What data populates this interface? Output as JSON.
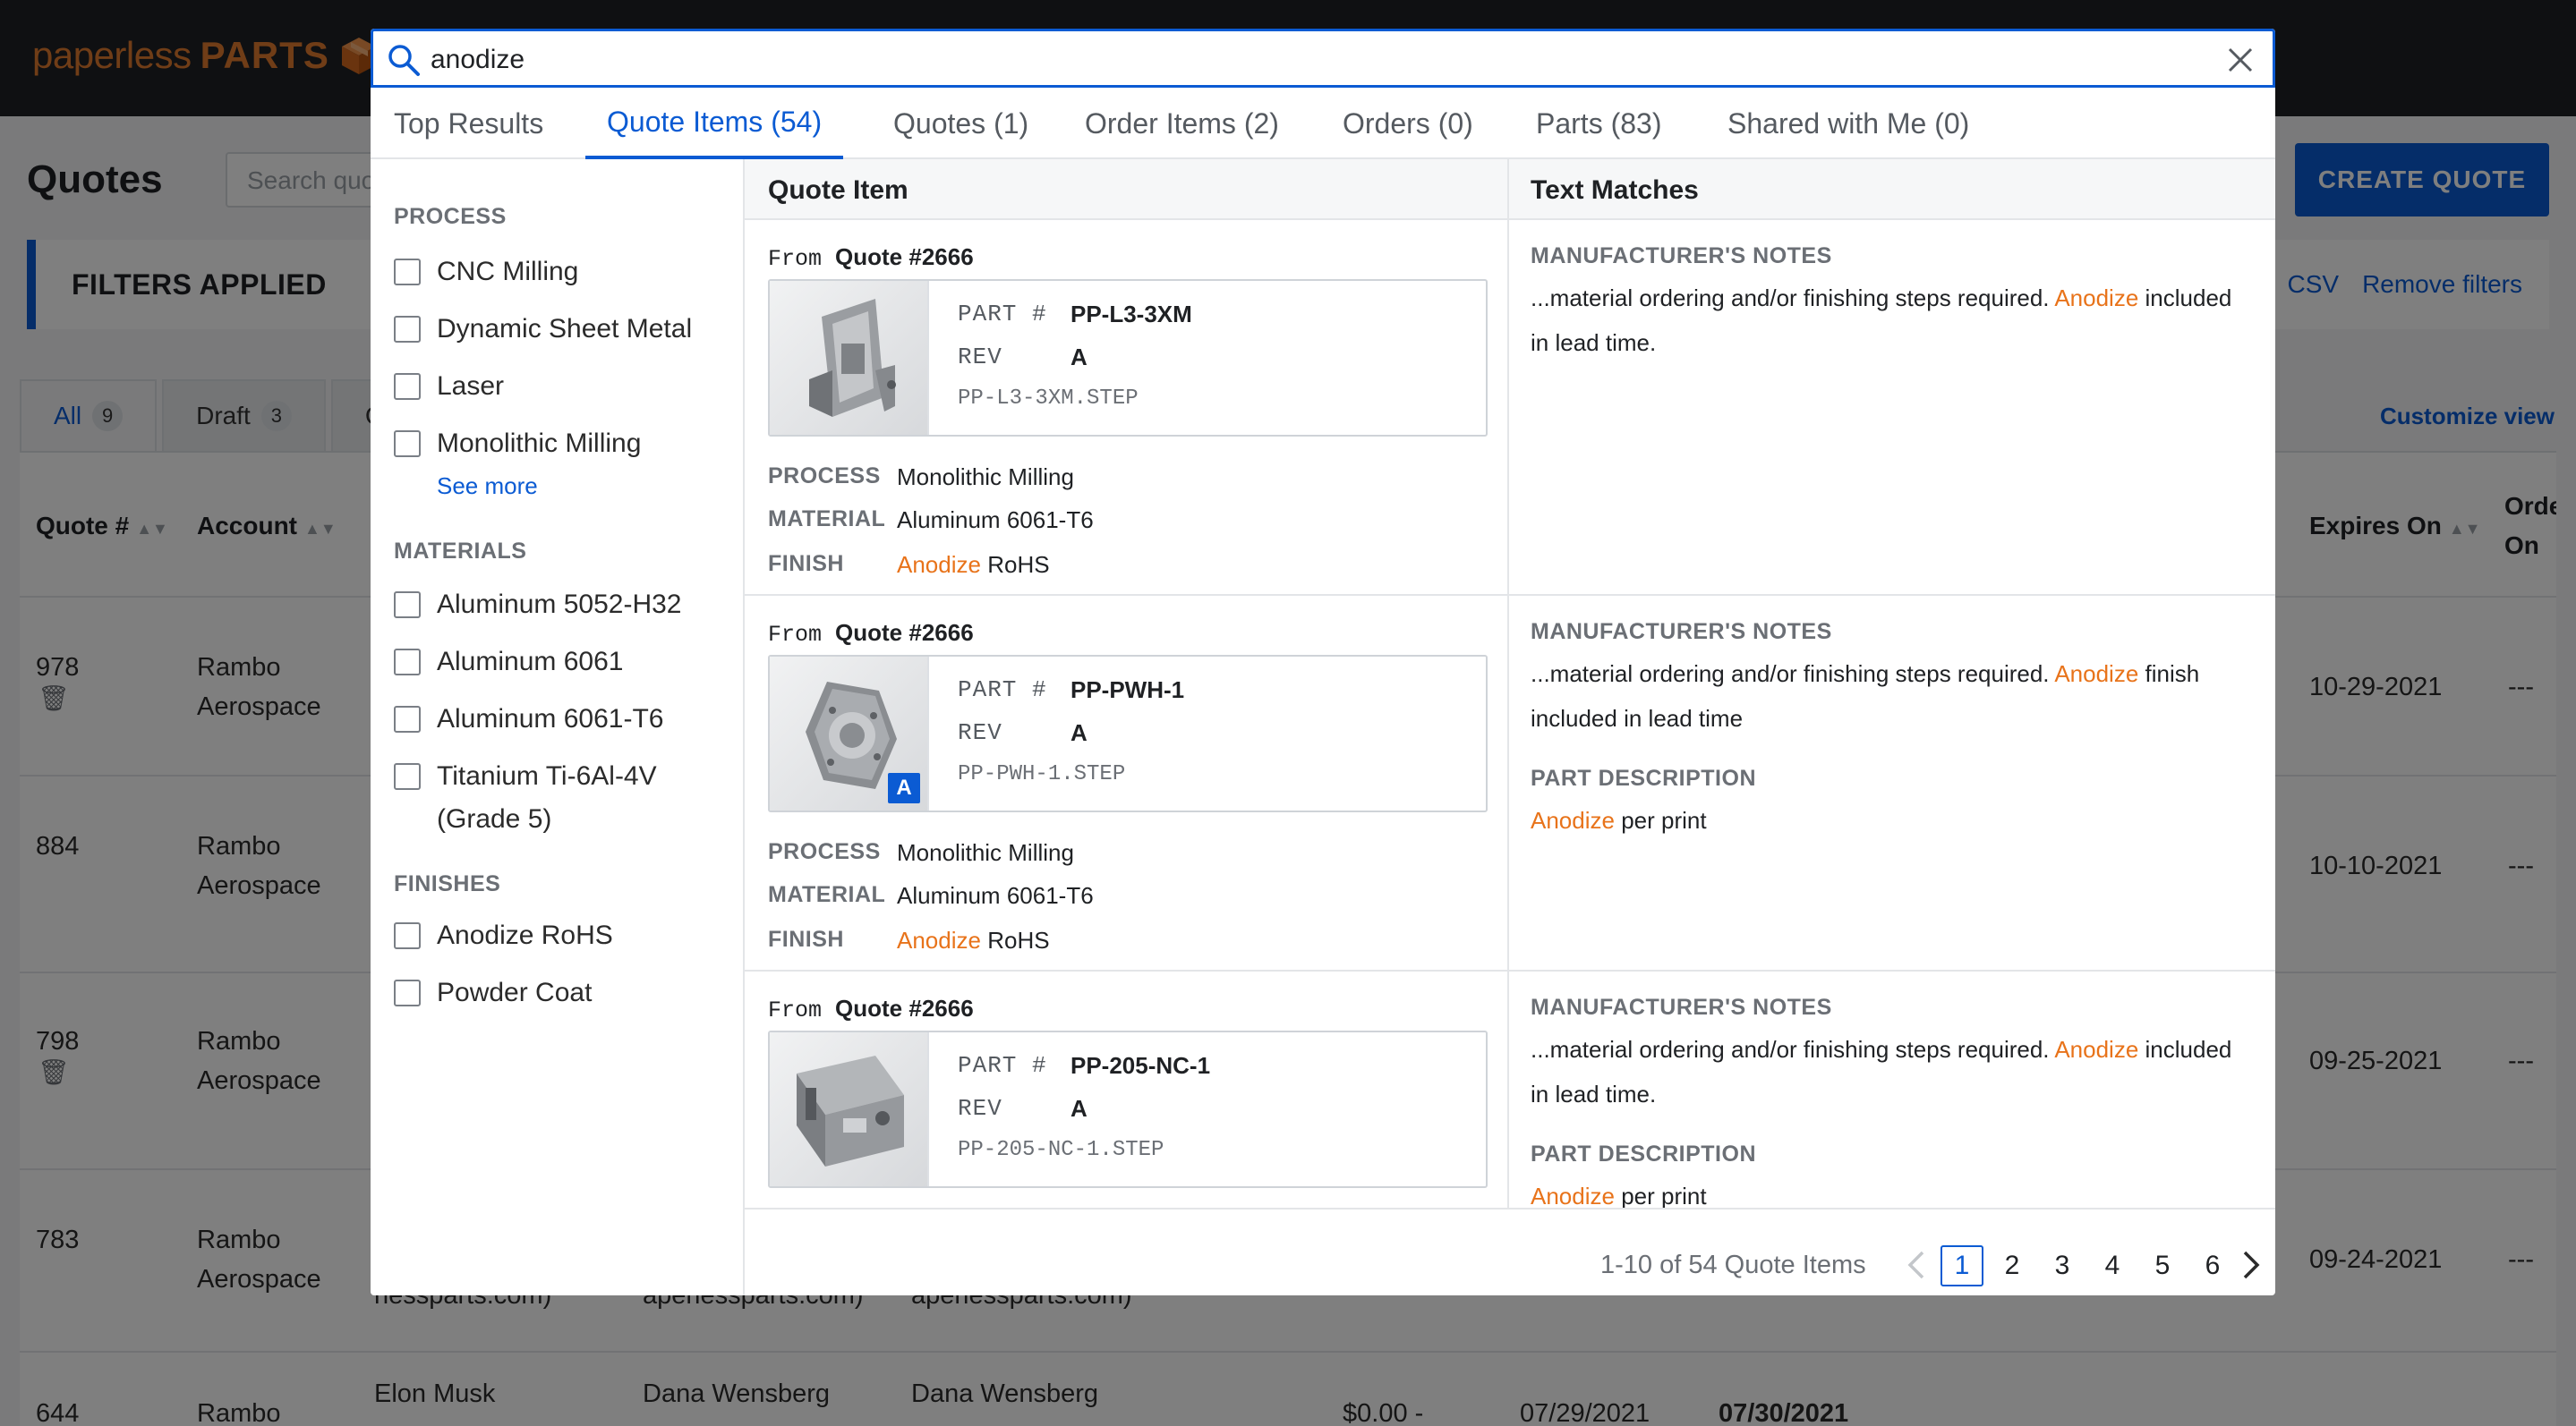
{
  "app": {
    "logo_light": "paperless",
    "logo_bold": "PARTS",
    "page_title": "Quotes",
    "search_placeholder": "Search quotes",
    "create_quote_label": "CREATE QUOTE",
    "filters_applied_label": "FILTERS APPLIED",
    "export_label": "CSV",
    "remove_filters_label": "Remove filters",
    "view_tabs": [
      {
        "label": "All",
        "count": "9"
      },
      {
        "label": "Draft",
        "count": "3"
      },
      {
        "label": "C",
        "count": ""
      }
    ],
    "customize_view_label": "Customize view",
    "columns": [
      "Quote #",
      "Account",
      "Expires On",
      "Orde On"
    ],
    "rows": [
      {
        "quote": "978",
        "account": "Rambo Aerospace",
        "expires": "10-29-2021",
        "order": "---",
        "trash": true
      },
      {
        "quote": "884",
        "account": "Rambo Aerospace",
        "expires": "10-10-2021",
        "order": "---",
        "trash": false
      },
      {
        "quote": "798",
        "account": "Rambo Aerospace",
        "expires": "09-25-2021",
        "order": "---",
        "trash": true
      },
      {
        "quote": "783",
        "account": "Rambo Aerospace",
        "expires": "09-24-2021",
        "order": "---",
        "trash": false
      },
      {
        "quote": "644",
        "account": "Rambo",
        "expires": "",
        "order": "",
        "trash": false
      }
    ],
    "partial_text": {
      "email_a": "nessparts.com)",
      "email_b": "aperlessparts.com)",
      "email_c": "aperlessparts.com)",
      "contact": "Elon Musk",
      "rep_a": "Dana Wensberg",
      "rep_b": "Dana Wensberg",
      "price": "$0.00 -",
      "date_a": "07/29/2021",
      "date_b": "07/30/2021"
    }
  },
  "search": {
    "query": "anodize",
    "tabs": [
      {
        "label": "Top Results"
      },
      {
        "label": "Quote Items (54)"
      },
      {
        "label": "Quotes (1)"
      },
      {
        "label": "Order Items (2)"
      },
      {
        "label": "Orders (0)"
      },
      {
        "label": "Parts (83)"
      },
      {
        "label": "Shared with Me (0)"
      }
    ],
    "active_tab": "Quote Items (54)"
  },
  "facets": {
    "process_title": "PROCESS",
    "process": [
      "CNC Milling",
      "Dynamic Sheet Metal",
      "Laser",
      "Monolithic Milling"
    ],
    "see_more": "See more",
    "materials_title": "MATERIALS",
    "materials": [
      "Aluminum 5052-H32",
      "Aluminum 6061",
      "Aluminum 6061-T6",
      "Titanium Ti-6Al-4V",
      "(Grade 5)"
    ],
    "finishes_title": "FINISHES",
    "finishes": [
      "Anodize RoHS",
      "Powder Coat"
    ]
  },
  "results": {
    "col_quote_item": "Quote Item",
    "col_text_matches": "Text Matches",
    "labels": {
      "from": "From",
      "part_no": "PART #",
      "rev": "REV",
      "process": "PROCESS",
      "material": "MATERIAL",
      "finish": "FINISH",
      "manufacturer_notes": "MANUFACTURER'S NOTES",
      "part_description": "PART DESCRIPTION"
    },
    "items": [
      {
        "quote": "Quote #2666",
        "part_number": "PP-L3-3XM",
        "rev": "A",
        "file": "PP-L3-3XM.STEP",
        "process": "Monolithic Milling",
        "material": "Aluminum 6061-T6",
        "finish_hl": "Anodize",
        "finish_rest": "RoHS",
        "notes_pre": "...material ordering and/or finishing steps required.",
        "notes_hl": "Anodize",
        "notes_post": "included in lead time.",
        "desc_hl": "",
        "desc_post": ""
      },
      {
        "quote": "Quote #2666",
        "part_number": "PP-PWH-1",
        "rev": "A",
        "file": "PP-PWH-1.STEP",
        "badge": "A",
        "process": "Monolithic Milling",
        "material": "Aluminum 6061-T6",
        "finish_hl": "Anodize",
        "finish_rest": "RoHS",
        "notes_pre": "...material ordering and/or finishing steps required.",
        "notes_hl": "Anodize",
        "notes_post": "finish included in lead time",
        "desc_hl": "Anodize",
        "desc_post": "per print"
      },
      {
        "quote": "Quote #2666",
        "part_number": "PP-205-NC-1",
        "rev": "A",
        "file": "PP-205-NC-1.STEP",
        "notes_pre": "...material ordering and/or finishing steps required.",
        "notes_hl": "Anodize",
        "notes_post": "included in lead time.",
        "desc_hl": "Anodize",
        "desc_post": "per print"
      }
    ]
  },
  "pagination": {
    "summary": "1-10 of 54 Quote Items",
    "pages": [
      "1",
      "2",
      "3",
      "4",
      "5",
      "6"
    ],
    "current": "1"
  },
  "colors": {
    "accent": "#0b5bd3",
    "highlight": "#e8731a",
    "brand": "#e07a2f",
    "topbar": "#1f2124"
  },
  "icons": [
    "search-icon",
    "close-icon",
    "chevron-left-icon",
    "chevron-right-icon",
    "trash-icon",
    "sort-icon",
    "logo-cube-icon"
  ]
}
